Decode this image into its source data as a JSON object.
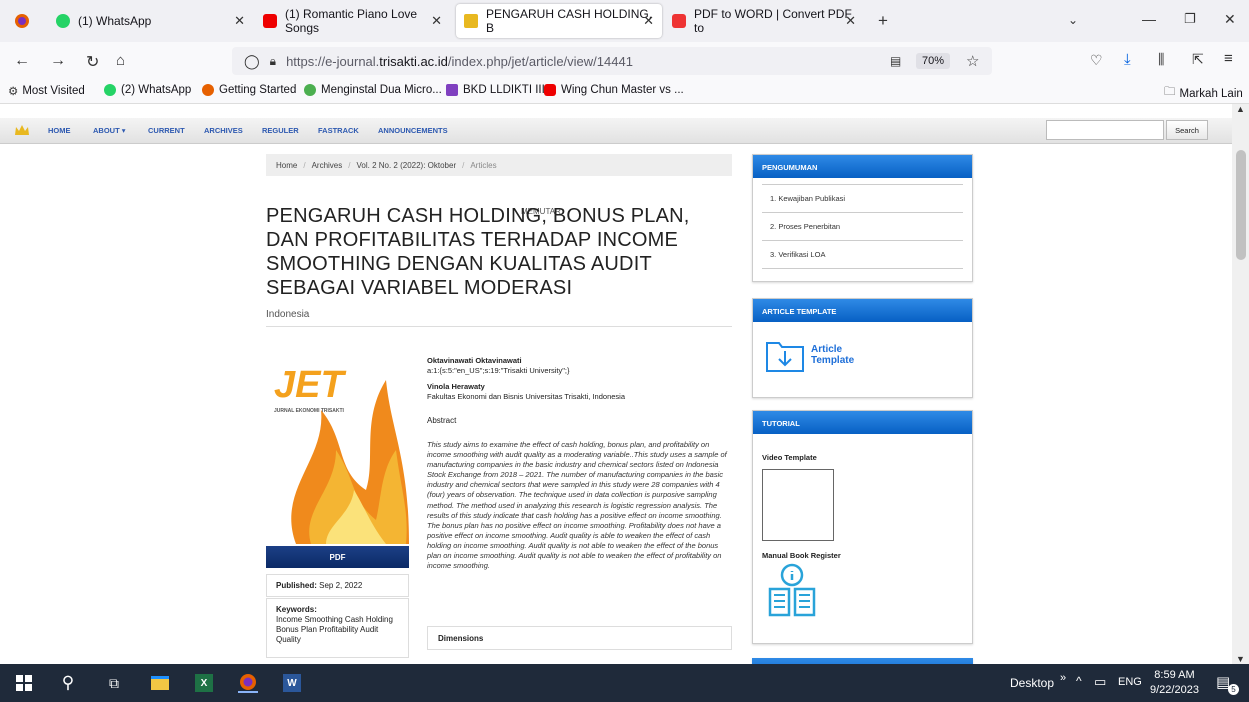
{
  "browser": {
    "tabs": [
      {
        "label": "(1) WhatsApp"
      },
      {
        "label": "(1) Romantic Piano Love Songs",
        "sub": "MEMUTAR"
      },
      {
        "label": "PENGARUH CASH HOLDING, B"
      },
      {
        "label": "PDF to WORD | Convert PDF to"
      }
    ],
    "url_prefix": "https://e-journal.",
    "url_domain": "trisakti.ac.id",
    "url_path": "/index.php/jet/article/view/14441",
    "zoom": "70%",
    "bookmarks": [
      "Most Visited",
      "(2) WhatsApp",
      "Getting Started",
      "Menginstal Dua Micro...",
      "BKD LLDIKTI III",
      "Wing Chun Master vs ..."
    ],
    "other_bookmarks": "Markah Lain"
  },
  "site": {
    "nav": [
      "HOME",
      "ABOUT ▾",
      "CURRENT",
      "ARCHIVES",
      "REGULER",
      "FASTRACK",
      "ANNOUNCEMENTS"
    ],
    "search_label": "Search"
  },
  "breadcrumb": [
    "Home",
    "Archives",
    "Vol. 2 No. 2 (2022): Oktober",
    "Articles"
  ],
  "article": {
    "title": "PENGARUH CASH HOLDING, BONUS PLAN, DAN PROFITABILITAS TERHADAP INCOME SMOOTHING DENGAN KUALITAS AUDIT SEBAGAI VARIABEL MODERASI",
    "subtitle": "Indonesia",
    "pdf_label": "PDF",
    "published_label": "Published:",
    "published_date": "Sep 2, 2022",
    "keywords_label": "Keywords:",
    "keywords": "Income Smoothing Cash Holding Bonus Plan Profitability Audit Quality",
    "author1": "Oktavinawati Oktavinawati",
    "author1_aff": "a:1:{s:5:\"en_US\";s:19:\"Trisakti University\";}",
    "author2": "Vinola Herawaty",
    "author2_aff": "Fakultas Ekonomi dan Bisnis Universitas Trisakti, Indonesia",
    "abstract_label": "Abstract",
    "abstract": "This study aims to examine the effect of cash holding, bonus plan, and profitability on income smoothing with audit quality as a moderating variable..This study uses a sample of manufacturing companies in the basic industry and chemical sectors listed on Indonesia Stock Exchange from 2018 – 2021. The number of  manufacturing companies in the basic industry and chemical sectors that were sampled in this study were 28 companies with 4 (four) years of observation. The technique used in data collection is purposive sampling method. The method used in analyzing this research is logistic regression analysis. The results of this study indicate that cash holding has a positive effect on income smoothing. The bonus plan has no positive effect on income smoothing. Profitability does not have a positive effect on income smoothing. Audit quality is able to weaken the effect of cash holding on income smoothing. Audit quality is not able to weaken the effect of the bonus plan on income smoothing. Audit quality is not able to weaken the effect of profitability on income smoothing.",
    "dimensions_label": "Dimensions",
    "cover_title": "JET",
    "cover_sub": "JURNAL EKONOMI TRISAKTI"
  },
  "sidebar": {
    "pengumuman": {
      "title": "PENGUMUMAN",
      "items": [
        "1. Kewajiban Publikasi",
        "2. Proses Penerbitan",
        "3. Verifikasi LOA"
      ]
    },
    "template": {
      "title": "ARTICLE TEMPLATE",
      "label": "Article Template"
    },
    "tutorial": {
      "title": "TUTORIAL",
      "video": "Video Template",
      "manual": "Manual Book Register"
    }
  },
  "taskbar": {
    "desktop": "Desktop",
    "lang": "ENG",
    "time": "8:59 AM",
    "date": "9/22/2023",
    "badge": "5"
  },
  "colors": {
    "accent": "#0760c4",
    "nav_link": "#2d59b0",
    "taskbar": "#1f2a3a"
  }
}
